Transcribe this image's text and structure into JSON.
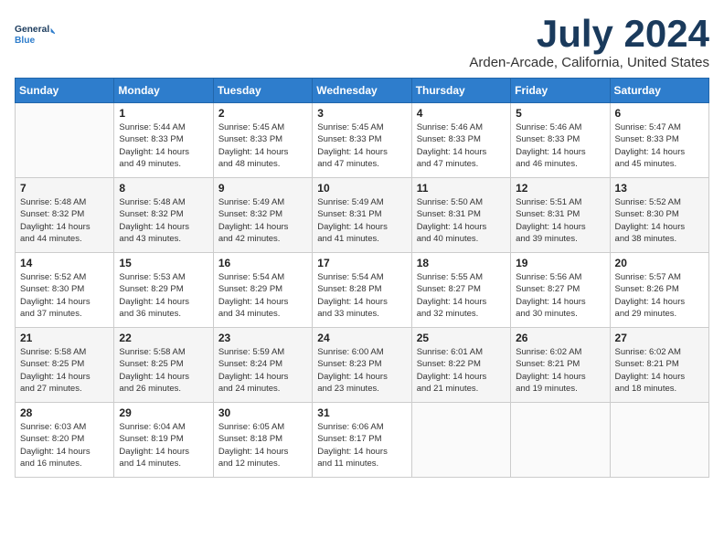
{
  "logo": {
    "line1": "General",
    "line2": "Blue"
  },
  "title": "July 2024",
  "location": "Arden-Arcade, California, United States",
  "header_days": [
    "Sunday",
    "Monday",
    "Tuesday",
    "Wednesday",
    "Thursday",
    "Friday",
    "Saturday"
  ],
  "weeks": [
    [
      {
        "num": "",
        "info": ""
      },
      {
        "num": "1",
        "info": "Sunrise: 5:44 AM\nSunset: 8:33 PM\nDaylight: 14 hours\nand 49 minutes."
      },
      {
        "num": "2",
        "info": "Sunrise: 5:45 AM\nSunset: 8:33 PM\nDaylight: 14 hours\nand 48 minutes."
      },
      {
        "num": "3",
        "info": "Sunrise: 5:45 AM\nSunset: 8:33 PM\nDaylight: 14 hours\nand 47 minutes."
      },
      {
        "num": "4",
        "info": "Sunrise: 5:46 AM\nSunset: 8:33 PM\nDaylight: 14 hours\nand 47 minutes."
      },
      {
        "num": "5",
        "info": "Sunrise: 5:46 AM\nSunset: 8:33 PM\nDaylight: 14 hours\nand 46 minutes."
      },
      {
        "num": "6",
        "info": "Sunrise: 5:47 AM\nSunset: 8:33 PM\nDaylight: 14 hours\nand 45 minutes."
      }
    ],
    [
      {
        "num": "7",
        "info": "Sunrise: 5:48 AM\nSunset: 8:32 PM\nDaylight: 14 hours\nand 44 minutes."
      },
      {
        "num": "8",
        "info": "Sunrise: 5:48 AM\nSunset: 8:32 PM\nDaylight: 14 hours\nand 43 minutes."
      },
      {
        "num": "9",
        "info": "Sunrise: 5:49 AM\nSunset: 8:32 PM\nDaylight: 14 hours\nand 42 minutes."
      },
      {
        "num": "10",
        "info": "Sunrise: 5:49 AM\nSunset: 8:31 PM\nDaylight: 14 hours\nand 41 minutes."
      },
      {
        "num": "11",
        "info": "Sunrise: 5:50 AM\nSunset: 8:31 PM\nDaylight: 14 hours\nand 40 minutes."
      },
      {
        "num": "12",
        "info": "Sunrise: 5:51 AM\nSunset: 8:31 PM\nDaylight: 14 hours\nand 39 minutes."
      },
      {
        "num": "13",
        "info": "Sunrise: 5:52 AM\nSunset: 8:30 PM\nDaylight: 14 hours\nand 38 minutes."
      }
    ],
    [
      {
        "num": "14",
        "info": "Sunrise: 5:52 AM\nSunset: 8:30 PM\nDaylight: 14 hours\nand 37 minutes."
      },
      {
        "num": "15",
        "info": "Sunrise: 5:53 AM\nSunset: 8:29 PM\nDaylight: 14 hours\nand 36 minutes."
      },
      {
        "num": "16",
        "info": "Sunrise: 5:54 AM\nSunset: 8:29 PM\nDaylight: 14 hours\nand 34 minutes."
      },
      {
        "num": "17",
        "info": "Sunrise: 5:54 AM\nSunset: 8:28 PM\nDaylight: 14 hours\nand 33 minutes."
      },
      {
        "num": "18",
        "info": "Sunrise: 5:55 AM\nSunset: 8:27 PM\nDaylight: 14 hours\nand 32 minutes."
      },
      {
        "num": "19",
        "info": "Sunrise: 5:56 AM\nSunset: 8:27 PM\nDaylight: 14 hours\nand 30 minutes."
      },
      {
        "num": "20",
        "info": "Sunrise: 5:57 AM\nSunset: 8:26 PM\nDaylight: 14 hours\nand 29 minutes."
      }
    ],
    [
      {
        "num": "21",
        "info": "Sunrise: 5:58 AM\nSunset: 8:25 PM\nDaylight: 14 hours\nand 27 minutes."
      },
      {
        "num": "22",
        "info": "Sunrise: 5:58 AM\nSunset: 8:25 PM\nDaylight: 14 hours\nand 26 minutes."
      },
      {
        "num": "23",
        "info": "Sunrise: 5:59 AM\nSunset: 8:24 PM\nDaylight: 14 hours\nand 24 minutes."
      },
      {
        "num": "24",
        "info": "Sunrise: 6:00 AM\nSunset: 8:23 PM\nDaylight: 14 hours\nand 23 minutes."
      },
      {
        "num": "25",
        "info": "Sunrise: 6:01 AM\nSunset: 8:22 PM\nDaylight: 14 hours\nand 21 minutes."
      },
      {
        "num": "26",
        "info": "Sunrise: 6:02 AM\nSunset: 8:21 PM\nDaylight: 14 hours\nand 19 minutes."
      },
      {
        "num": "27",
        "info": "Sunrise: 6:02 AM\nSunset: 8:21 PM\nDaylight: 14 hours\nand 18 minutes."
      }
    ],
    [
      {
        "num": "28",
        "info": "Sunrise: 6:03 AM\nSunset: 8:20 PM\nDaylight: 14 hours\nand 16 minutes."
      },
      {
        "num": "29",
        "info": "Sunrise: 6:04 AM\nSunset: 8:19 PM\nDaylight: 14 hours\nand 14 minutes."
      },
      {
        "num": "30",
        "info": "Sunrise: 6:05 AM\nSunset: 8:18 PM\nDaylight: 14 hours\nand 12 minutes."
      },
      {
        "num": "31",
        "info": "Sunrise: 6:06 AM\nSunset: 8:17 PM\nDaylight: 14 hours\nand 11 minutes."
      },
      {
        "num": "",
        "info": ""
      },
      {
        "num": "",
        "info": ""
      },
      {
        "num": "",
        "info": ""
      }
    ]
  ]
}
